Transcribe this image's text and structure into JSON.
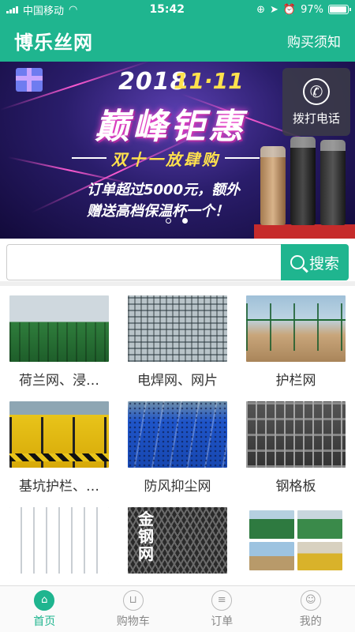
{
  "status_bar": {
    "carrier": "中国移动",
    "time": "15:42",
    "battery": "97%"
  },
  "header": {
    "title": "博乐丝网",
    "notice_link": "购买须知"
  },
  "banner": {
    "year": "2018",
    "event": "11·11",
    "headline": "巅峰钜惠",
    "subline": "双十一放肆购",
    "promo_line1": "订单超过5000元，额外",
    "promo_line2": "赠送高档保温杯一个！",
    "dial_label": "拨打电话",
    "slides_count": 2,
    "active_slide": 2
  },
  "search": {
    "placeholder": "",
    "button_label": "搜索"
  },
  "products": [
    {
      "label": "荷兰网、浸…"
    },
    {
      "label": "电焊网、网片"
    },
    {
      "label": "护栏网"
    },
    {
      "label": "基坑护栏、…"
    },
    {
      "label": "防风抑尘网"
    },
    {
      "label": "钢格板"
    },
    {
      "label": ""
    },
    {
      "label": "",
      "stamp": "金钢网"
    },
    {
      "label": ""
    }
  ],
  "tabbar": {
    "items": [
      {
        "label": "首页",
        "icon": "home-icon",
        "active": true
      },
      {
        "label": "购物车",
        "icon": "cart-icon",
        "active": false
      },
      {
        "label": "订单",
        "icon": "order-icon",
        "active": false
      },
      {
        "label": "我的",
        "icon": "user-icon",
        "active": false
      }
    ]
  },
  "colors": {
    "brand": "#1fb58f"
  }
}
